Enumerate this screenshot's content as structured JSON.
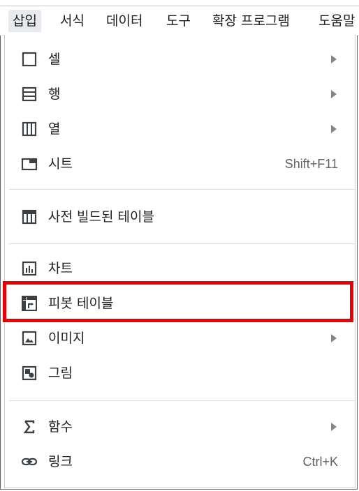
{
  "menubar": {
    "items": [
      {
        "label": "삽입",
        "active": true
      },
      {
        "label": "서식"
      },
      {
        "label": "데이터"
      },
      {
        "label": "도구"
      },
      {
        "label": "확장 프로그램"
      },
      {
        "label": "도움말"
      }
    ]
  },
  "menu": {
    "cell": {
      "label": "셀",
      "icon": "cell-icon",
      "submenu": true
    },
    "row": {
      "label": "행",
      "icon": "row-icon",
      "submenu": true
    },
    "column": {
      "label": "열",
      "icon": "column-icon",
      "submenu": true
    },
    "sheet": {
      "label": "시트",
      "icon": "sheet-icon",
      "shortcut": "Shift+F11"
    },
    "prebuilt_table": {
      "label": "사전 빌드된 테이블",
      "icon": "table-icon"
    },
    "chart": {
      "label": "차트",
      "icon": "chart-icon"
    },
    "pivot_table": {
      "label": "피봇 테이블",
      "icon": "pivot-table-icon",
      "highlighted": true
    },
    "image": {
      "label": "이미지",
      "icon": "image-icon",
      "submenu": true
    },
    "drawing": {
      "label": "그림",
      "icon": "drawing-icon"
    },
    "function": {
      "label": "함수",
      "icon": "sigma-icon",
      "submenu": true
    },
    "link": {
      "label": "링크",
      "icon": "link-icon",
      "shortcut": "Ctrl+K"
    }
  },
  "colors": {
    "highlight": "#e80000",
    "active_menu_bg": "#e8eaed",
    "icon": "#3c4043"
  }
}
